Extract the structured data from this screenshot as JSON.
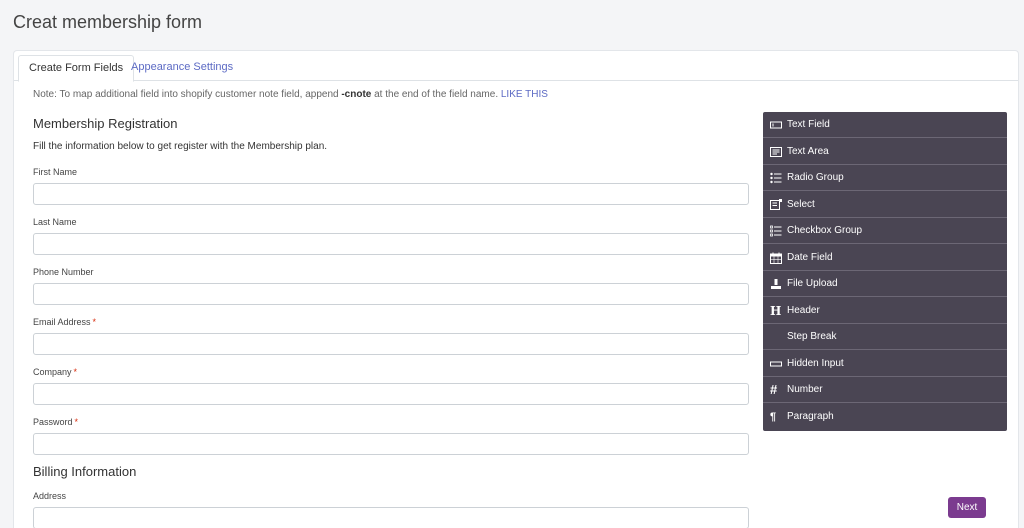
{
  "page": {
    "title": "Creat membership form"
  },
  "tabs": [
    {
      "label": "Create Form Fields",
      "active": true
    },
    {
      "label": "Appearance Settings",
      "active": false
    }
  ],
  "note": {
    "prefix": "Note: To map additional field into shopify customer note field, append ",
    "code": "-cnote",
    "suffix": " at the end of the field name. ",
    "link": "LIKE THIS"
  },
  "form": {
    "section1_title": "Membership Registration",
    "section1_desc": "Fill the information below to get register with the Membership plan.",
    "section2_title": "Billing Information",
    "fields": [
      {
        "label": "First Name",
        "required": false,
        "value": ""
      },
      {
        "label": "Last Name",
        "required": false,
        "value": ""
      },
      {
        "label": "Phone Number",
        "required": false,
        "value": ""
      },
      {
        "label": "Email Address",
        "required": true,
        "value": ""
      },
      {
        "label": "Company",
        "required": true,
        "value": ""
      },
      {
        "label": "Password",
        "required": true,
        "value": ""
      },
      {
        "label": "Address",
        "required": false,
        "value": ""
      }
    ],
    "required_mark": "*"
  },
  "palette": {
    "items": [
      {
        "label": "Text Field",
        "icon": "text-field-icon"
      },
      {
        "label": "Text Area",
        "icon": "text-area-icon"
      },
      {
        "label": "Radio Group",
        "icon": "radio-group-icon"
      },
      {
        "label": "Select",
        "icon": "select-icon"
      },
      {
        "label": "Checkbox Group",
        "icon": "checkbox-group-icon"
      },
      {
        "label": "Date Field",
        "icon": "calendar-icon"
      },
      {
        "label": "File Upload",
        "icon": "upload-icon"
      },
      {
        "label": "Header",
        "icon": "header-icon"
      },
      {
        "label": "Step Break",
        "icon": ""
      },
      {
        "label": "Hidden Input",
        "icon": "hidden-input-icon"
      },
      {
        "label": "Number",
        "icon": "hash-icon"
      },
      {
        "label": "Paragraph",
        "icon": "pilcrow-icon"
      }
    ]
  },
  "actions": {
    "next_label": "Next"
  },
  "colors": {
    "accent": "#5c6ac4",
    "button": "#7b3b8f",
    "palette_bg": "#4a4553",
    "required": "#d72c0d"
  }
}
